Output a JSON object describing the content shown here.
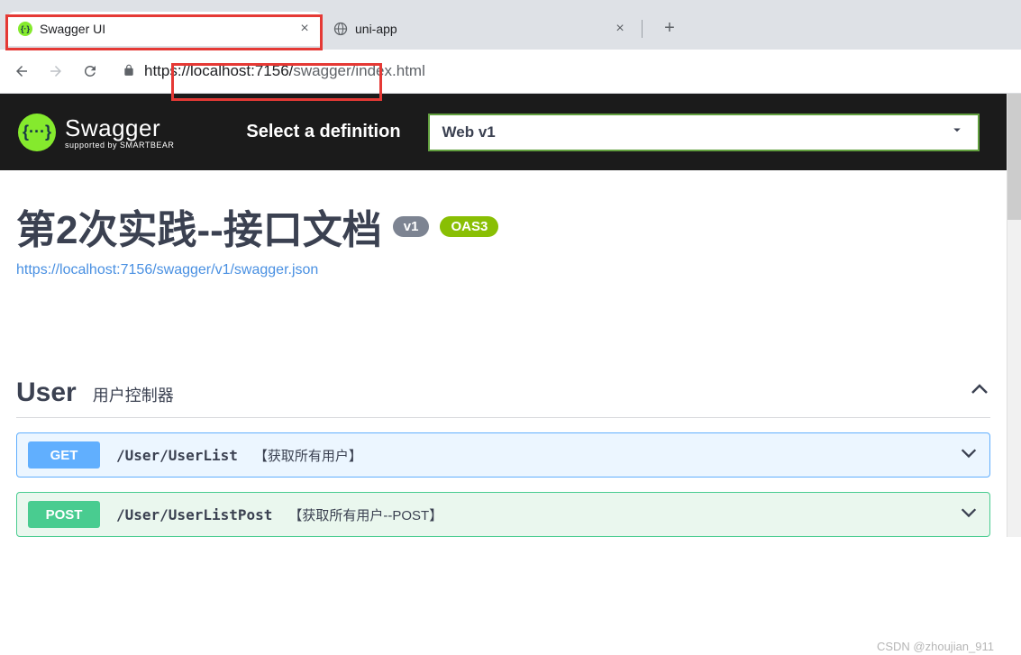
{
  "browser": {
    "tabs": [
      {
        "title": "Swagger UI",
        "active": true,
        "favicon": "swagger"
      },
      {
        "title": "uni-app",
        "active": false,
        "favicon": "globe"
      }
    ],
    "url_host": "https://localhost:7156/",
    "url_path": "swagger/index.html"
  },
  "header": {
    "logo_main": "Swagger",
    "logo_sub": "supported by SMARTBEAR",
    "logo_glyph": "{···}",
    "def_label": "Select a definition",
    "def_selected": "Web v1"
  },
  "info": {
    "title": "第2次实践--接口文档",
    "version_badge": "v1",
    "oas_badge": "OAS3",
    "spec_link": "https://localhost:7156/swagger/v1/swagger.json"
  },
  "tag": {
    "name": "User",
    "desc": "用户控制器"
  },
  "operations": [
    {
      "method": "GET",
      "path": "/User/UserList",
      "summary": "【获取所有用户】"
    },
    {
      "method": "POST",
      "path": "/User/UserListPost",
      "summary": "【获取所有用户--POST】"
    }
  ],
  "watermark": "CSDN @zhoujian_911"
}
